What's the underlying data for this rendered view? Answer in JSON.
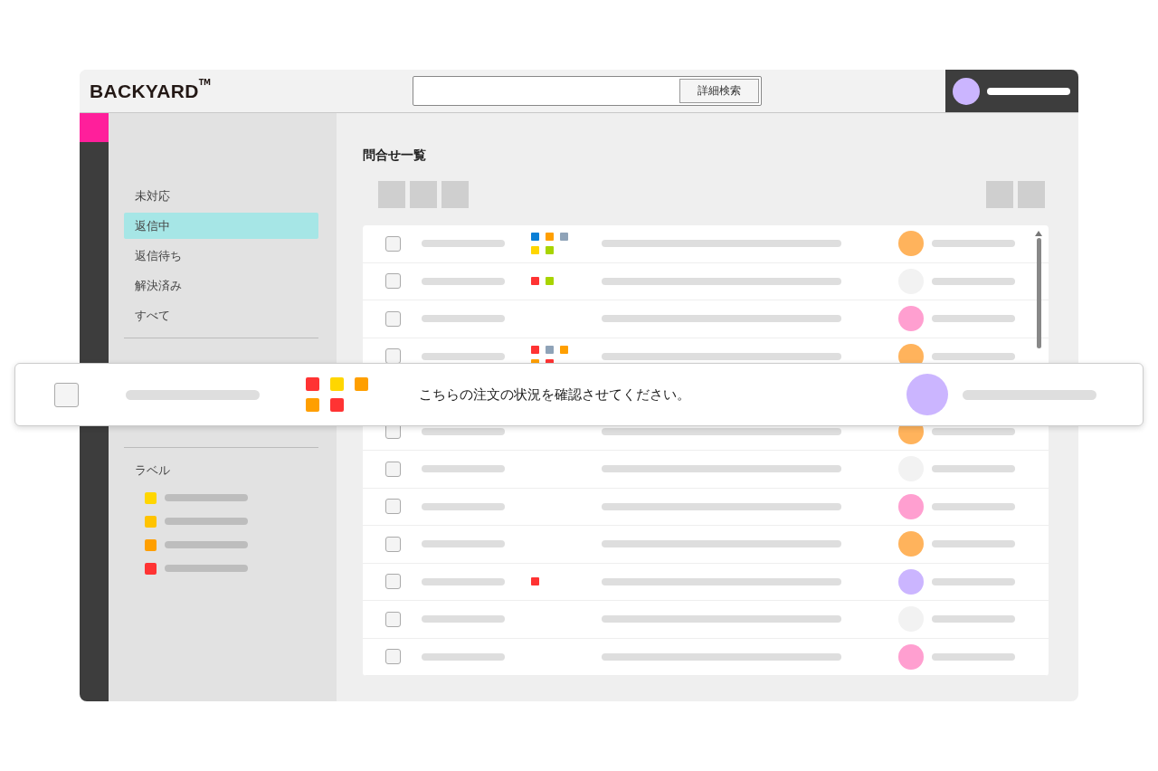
{
  "header": {
    "logo": "BACKYARD",
    "trademark": "TM",
    "search_button": "詳細検索",
    "user_avatar": {
      "color": "#cbb5ff"
    }
  },
  "sidebar": {
    "items": [
      {
        "label": "未対応",
        "selected": false
      },
      {
        "label": "返信中",
        "selected": true
      },
      {
        "label": "返信待ち",
        "selected": false
      },
      {
        "label": "解決済み",
        "selected": false
      },
      {
        "label": "すべて",
        "selected": false
      }
    ],
    "labels_heading": "ラベル",
    "labels": [
      {
        "color": "#ffd600"
      },
      {
        "color": "#ffc300"
      },
      {
        "color": "#ff9f00"
      },
      {
        "color": "#ff3333"
      }
    ]
  },
  "main": {
    "title": "問合せ一覧",
    "rows": [
      {
        "checked": false,
        "tags": [
          {
            "color": "#0a7fd6"
          },
          {
            "color": "#ff9f00"
          },
          {
            "color": "#8fa3b8"
          },
          {
            "color": "#ffd600"
          },
          {
            "color": "#a8d400"
          }
        ],
        "avatar": {
          "color": "#ffb35c"
        }
      },
      {
        "checked": false,
        "tags": [
          {
            "color": "#ff3333"
          },
          {
            "color": "#a8d400"
          }
        ],
        "avatar": {
          "color": "#f2f2f2"
        }
      },
      {
        "checked": false,
        "tags": [],
        "avatar": {
          "color": "#ff9fd0"
        }
      },
      {
        "checked": false,
        "tags": [
          {
            "color": "#ff3333"
          },
          {
            "color": "#8fa3b8"
          },
          {
            "color": "#ff9f00"
          },
          {
            "color": "#ff9f00"
          },
          {
            "color": "#ff3333"
          }
        ],
        "avatar": {
          "color": "#ffb35c"
        }
      },
      {
        "checked": false,
        "tags": [],
        "avatar": {
          "color": "#ffb35c"
        }
      },
      {
        "checked": false,
        "tags": [],
        "avatar": {
          "color": "#f2f2f2"
        }
      },
      {
        "checked": false,
        "tags": [],
        "avatar": {
          "color": "#ff9fd0"
        }
      },
      {
        "checked": false,
        "tags": [],
        "avatar": {
          "color": "#ffb35c"
        }
      },
      {
        "checked": false,
        "tags": [
          {
            "color": "#ff3333"
          }
        ],
        "avatar": {
          "color": "#cbb5ff"
        }
      },
      {
        "checked": false,
        "tags": [],
        "avatar": {
          "color": "#f2f2f2"
        }
      },
      {
        "checked": false,
        "tags": [],
        "avatar": {
          "color": "#ff9fd0"
        }
      }
    ]
  },
  "highlighted_row": {
    "checked": false,
    "tags": [
      {
        "color": "#ff3333"
      },
      {
        "color": "#ffd600"
      },
      {
        "color": "#ff9f00"
      },
      {
        "color": "#ff9f00"
      },
      {
        "color": "#ff3333"
      }
    ],
    "message": "こちらの注文の状況を確認させてください。",
    "avatar": {
      "color": "#cbb5ff"
    }
  }
}
